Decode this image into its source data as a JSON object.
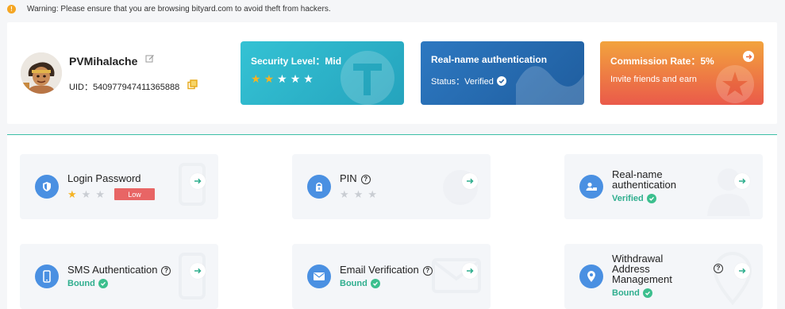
{
  "warning": {
    "text": "Warning: Please ensure that you are browsing bityard.com to avoid theft from hackers."
  },
  "profile": {
    "username": "PVMihalache",
    "uid": "UID：540977947411365888"
  },
  "cards": {
    "security": {
      "title": "Security Level：Mid",
      "stars_filled": 2,
      "stars_total": 5
    },
    "realname": {
      "title": "Real-name authentication",
      "status": "Status：Verified"
    },
    "commission": {
      "title": "Commission Rate：5%",
      "subtitle": "Invite friends and earn"
    }
  },
  "tiles": {
    "login_password": {
      "title": "Login Password",
      "badge": "Low",
      "stars_filled": 1,
      "stars_total": 3
    },
    "pin": {
      "title": "PIN",
      "stars_filled": 0,
      "stars_total": 3
    },
    "realname": {
      "title_line1": "Real-name",
      "title_line2": "authentication",
      "status": "Verified"
    },
    "sms": {
      "title": "SMS Authentication",
      "status": "Bound"
    },
    "email": {
      "title": "Email Verification",
      "status": "Bound"
    },
    "withdrawal": {
      "title_line1": "Withdrawal",
      "title_line2": "Address",
      "title_line3": "Management",
      "status": "Bound"
    }
  },
  "colors": {
    "accent_green": "#2fae8e",
    "star_gold": "#f5b323",
    "low_badge": "#e86565",
    "icon_blue": "#4a90e2"
  }
}
